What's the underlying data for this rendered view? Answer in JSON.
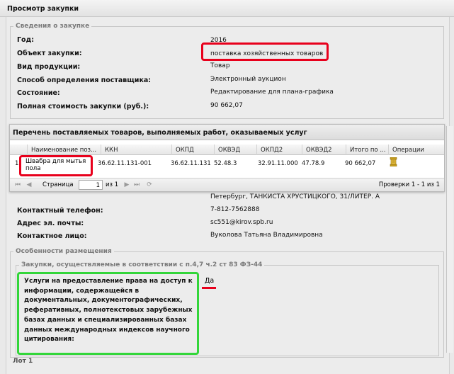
{
  "window": {
    "title": "Просмотр закупки"
  },
  "info": {
    "legend": "Сведения о закупке",
    "rows": [
      {
        "label": "Год:",
        "value": "2016"
      },
      {
        "label": "Объект закупки:",
        "value": "поставка хозяйственных товаров"
      },
      {
        "label": "Вид продукции:",
        "value": "Товар"
      },
      {
        "label": "Способ определения поставщика:",
        "value": "Электронный аукцион"
      },
      {
        "label": "Состояние:",
        "value": "Редактирование для плана-графика"
      },
      {
        "label": "Полная стоимость закупки (руб.):",
        "value": "90 662,07"
      }
    ]
  },
  "grid": {
    "title": "Перечень поставляемых товаров, выполняемых работ, оказываемых услуг",
    "columns": [
      "Наименование поз...",
      "ККН",
      "ОКПД",
      "ОКВЭД",
      "ОКПД2",
      "ОКВЭД2",
      "Итого по ...",
      "Операции"
    ],
    "row": {
      "num": "1",
      "name_line1": "Швабра для мытья",
      "name_line2": "пола",
      "kkn": "36.62.11.131-001",
      "okpd": "36.62.11.131",
      "okved": "52.48.3",
      "okpd2": "32.91.11.000",
      "okved2": "47.78.9",
      "total": "90 662,07"
    },
    "pager": {
      "page_label": "Страница",
      "page_value": "1",
      "of_label": "из 1",
      "records": "Проверки 1 - 1 из 1"
    }
  },
  "contact": {
    "address_tail": "Петербург, ТАНКИСТА ХРУСТИЦКОГО, 31/ЛИТЕР. А",
    "phone_label": "Контактный телефон:",
    "phone": "7-812-7562888",
    "email_label": "Адрес эл. почты:",
    "email": "sc551@kirov.spb.ru",
    "person_label": "Контактное лицо:",
    "person": "Вуколова Татьяна Владимировна"
  },
  "features": {
    "legend": "Особенности размещения",
    "sub_legend": "Закупки, осуществляемые в соответствии с п.4,7 ч.2 ст 83 ФЗ-44",
    "question_lines": [
      "Услуги на предоставление права на доступ к",
      "информации, содержащейся в",
      "документальных, документографических,",
      "реферативных, полнотекстовых зарубежных",
      "базах данных и специализированных базах",
      "данных международных индексов научного",
      "цитирования:"
    ],
    "answer": "Да"
  },
  "bottom": {
    "lot_label": "Лот 1"
  },
  "colors": {
    "highlight_red": "#e8001c",
    "highlight_green": "#33d63a"
  },
  "icons": [
    "first-page-icon",
    "prev-page-icon",
    "next-page-icon",
    "last-page-icon",
    "refresh-icon",
    "operations-icon"
  ]
}
